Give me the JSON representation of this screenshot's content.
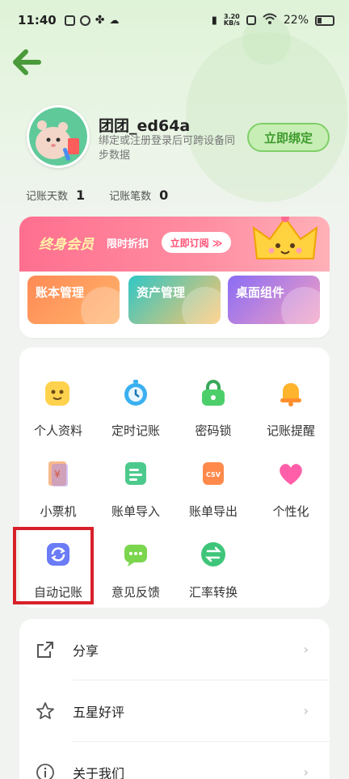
{
  "status_bar": {
    "time": "11:40",
    "net_speed_value": "3.20",
    "net_speed_unit": "KB/s",
    "battery": "22%"
  },
  "profile": {
    "username": "团团_ed64a",
    "subtitle": "绑定或注册登录后可跨设备同步数据",
    "bind_button": "立即绑定",
    "stats": [
      {
        "label": "记账天数",
        "value": "1"
      },
      {
        "label": "记账笔数",
        "value": "0"
      }
    ]
  },
  "vip": {
    "title": "终身会员",
    "subtitle": "限时折扣",
    "button": "立即订阅 ≫"
  },
  "quick_actions": [
    {
      "label": "账本管理"
    },
    {
      "label": "资产管理"
    },
    {
      "label": "桌面组件"
    }
  ],
  "grid": [
    {
      "label": "个人资料",
      "icon": "smiley-face-icon",
      "color": "#ffd24d"
    },
    {
      "label": "定时记账",
      "icon": "timer-icon",
      "color": "#3ab0f0"
    },
    {
      "label": "密码锁",
      "icon": "lock-icon",
      "color": "#4ccf6a"
    },
    {
      "label": "记账提醒",
      "icon": "bell-icon",
      "color": "#ffb42e"
    },
    {
      "label": "小票机",
      "icon": "receipt-icon",
      "color": "#f7b98a"
    },
    {
      "label": "账单导入",
      "icon": "import-icon",
      "color": "#4cc98c"
    },
    {
      "label": "账单导出",
      "icon": "csv-export-icon",
      "color": "#ff8a4c"
    },
    {
      "label": "个性化",
      "icon": "heart-icon",
      "color": "#ff5fa8"
    },
    {
      "label": "自动记账",
      "icon": "auto-sync-icon",
      "color": "#6b7cf6"
    },
    {
      "label": "意见反馈",
      "icon": "chat-bubble-icon",
      "color": "#7bd64e"
    },
    {
      "label": "汇率转换",
      "icon": "exchange-icon",
      "color": "#3fc57a"
    }
  ],
  "list": [
    {
      "label": "分享",
      "icon": "share-icon"
    },
    {
      "label": "五星好评",
      "icon": "star-icon"
    },
    {
      "label": "关于我们",
      "icon": "info-icon"
    }
  ],
  "colors": {
    "accent_green": "#7fcf67",
    "vip_pink": "#ff6f8f",
    "highlight_red": "#d8202a"
  }
}
